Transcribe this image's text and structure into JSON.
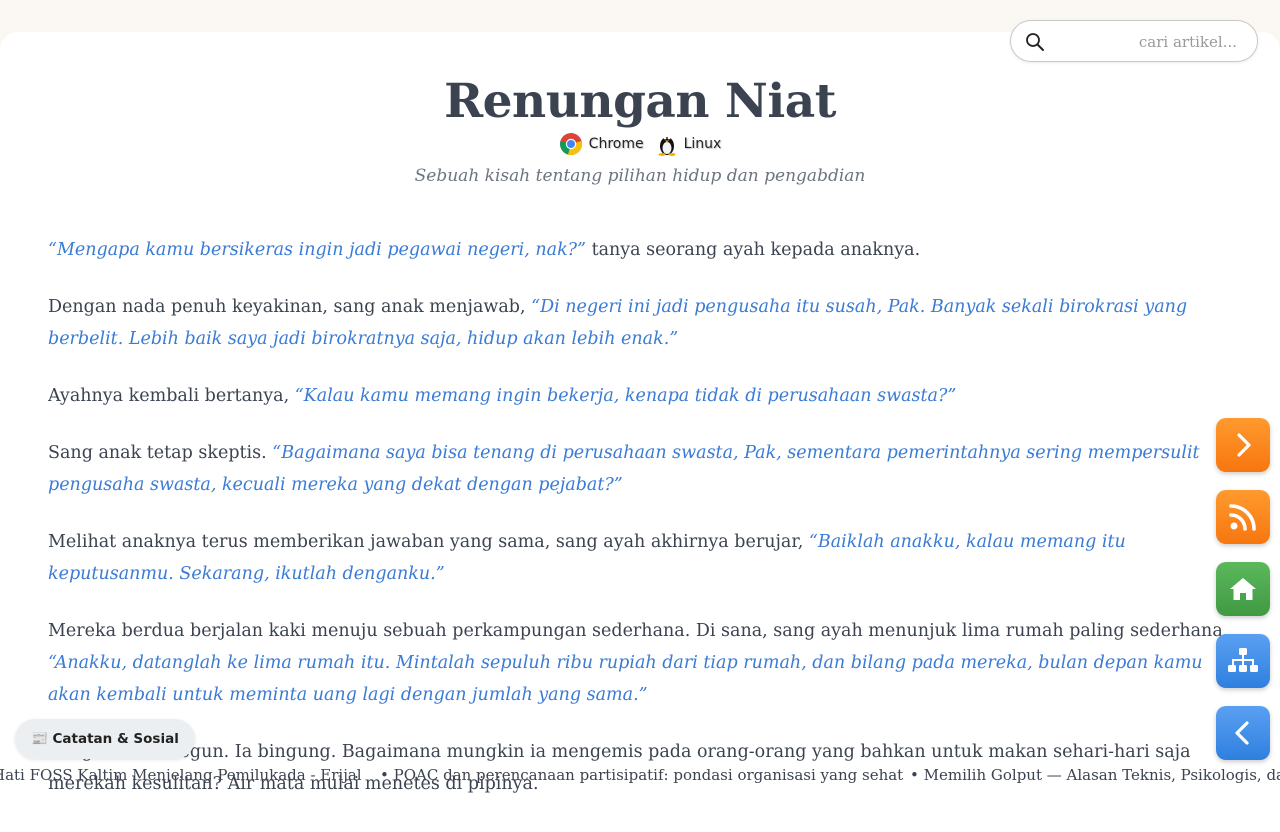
{
  "search": {
    "placeholder": "cari artikel..."
  },
  "article": {
    "title": "Renungan Niat",
    "badges": [
      {
        "icon": "chrome-icon",
        "label": "Chrome"
      },
      {
        "icon": "linux-tux-icon",
        "label": "Linux"
      }
    ],
    "subtitle": "Sebuah kisah tentang pilihan hidup dan pengabdian",
    "paragraphs": [
      {
        "quote_before": "“Mengapa kamu bersikeras ingin jadi pegawai negeri, nak?”",
        "text": " tanya seorang ayah kepada anaknya."
      },
      {
        "text": "Dengan nada penuh keyakinan, sang anak menjawab, ",
        "quote": "“Di negeri ini jadi pengusaha itu susah, Pak. Banyak sekali birokrasi yang berbelit. Lebih baik saya jadi birokratnya saja, hidup akan lebih enak.”"
      },
      {
        "text": "Ayahnya kembali bertanya, ",
        "quote": "“Kalau kamu memang ingin bekerja, kenapa tidak di perusahaan swasta?”"
      },
      {
        "text": "Sang anak tetap skeptis. ",
        "quote": "“Bagaimana saya bisa tenang di perusahaan swasta, Pak, sementara pemerintahnya sering mempersulit pengusaha swasta, kecuali mereka yang dekat dengan pejabat?”"
      },
      {
        "text": "Melihat anaknya terus memberikan jawaban yang sama, sang ayah akhirnya berujar, ",
        "quote": "“Baiklah anakku, kalau memang itu keputusanmu. Sekarang, ikutlah denganku.”"
      },
      {
        "text": "Mereka berdua berjalan kaki menuju sebuah perkampungan sederhana. Di sana, sang ayah menunjuk lima rumah paling sederhana. ",
        "quote": "“Anakku, datanglah ke lima rumah itu. Mintalah sepuluh ribu rupiah dari tiap rumah, dan bilang pada mereka, bulan depan kamu akan kembali untuk meminta uang lagi dengan jumlah yang sama.”"
      },
      {
        "text": "Sang anak tertegun. Ia bingung. Bagaimana mungkin ia mengemis pada orang-orang yang bahkan untuk makan sehari-hari saja merekah kesulitan? Air mata mulai menetes di pipinya."
      }
    ]
  },
  "side_buttons": [
    {
      "icon": "chevron-right-icon",
      "color": "#f7860f"
    },
    {
      "icon": "rss-icon",
      "color": "#f7860f"
    },
    {
      "icon": "home-icon",
      "color": "#4aa64c"
    },
    {
      "icon": "sitemap-icon",
      "color": "#3a86e8"
    },
    {
      "icon": "chevron-left-icon",
      "color": "#3a86e8"
    }
  ],
  "social_button": {
    "icon": "newspaper-icon",
    "label": "📰 Catatan & Sosial"
  },
  "ticker": [
    "Hati FOSS Kaltim Menjelang Pemilukada - Erijal",
    "• POAC dan perencanaan partisipatif: pondasi organisasi yang sehat",
    "• Memilih Golput — Alasan Teknis, Psikologis, dan"
  ]
}
